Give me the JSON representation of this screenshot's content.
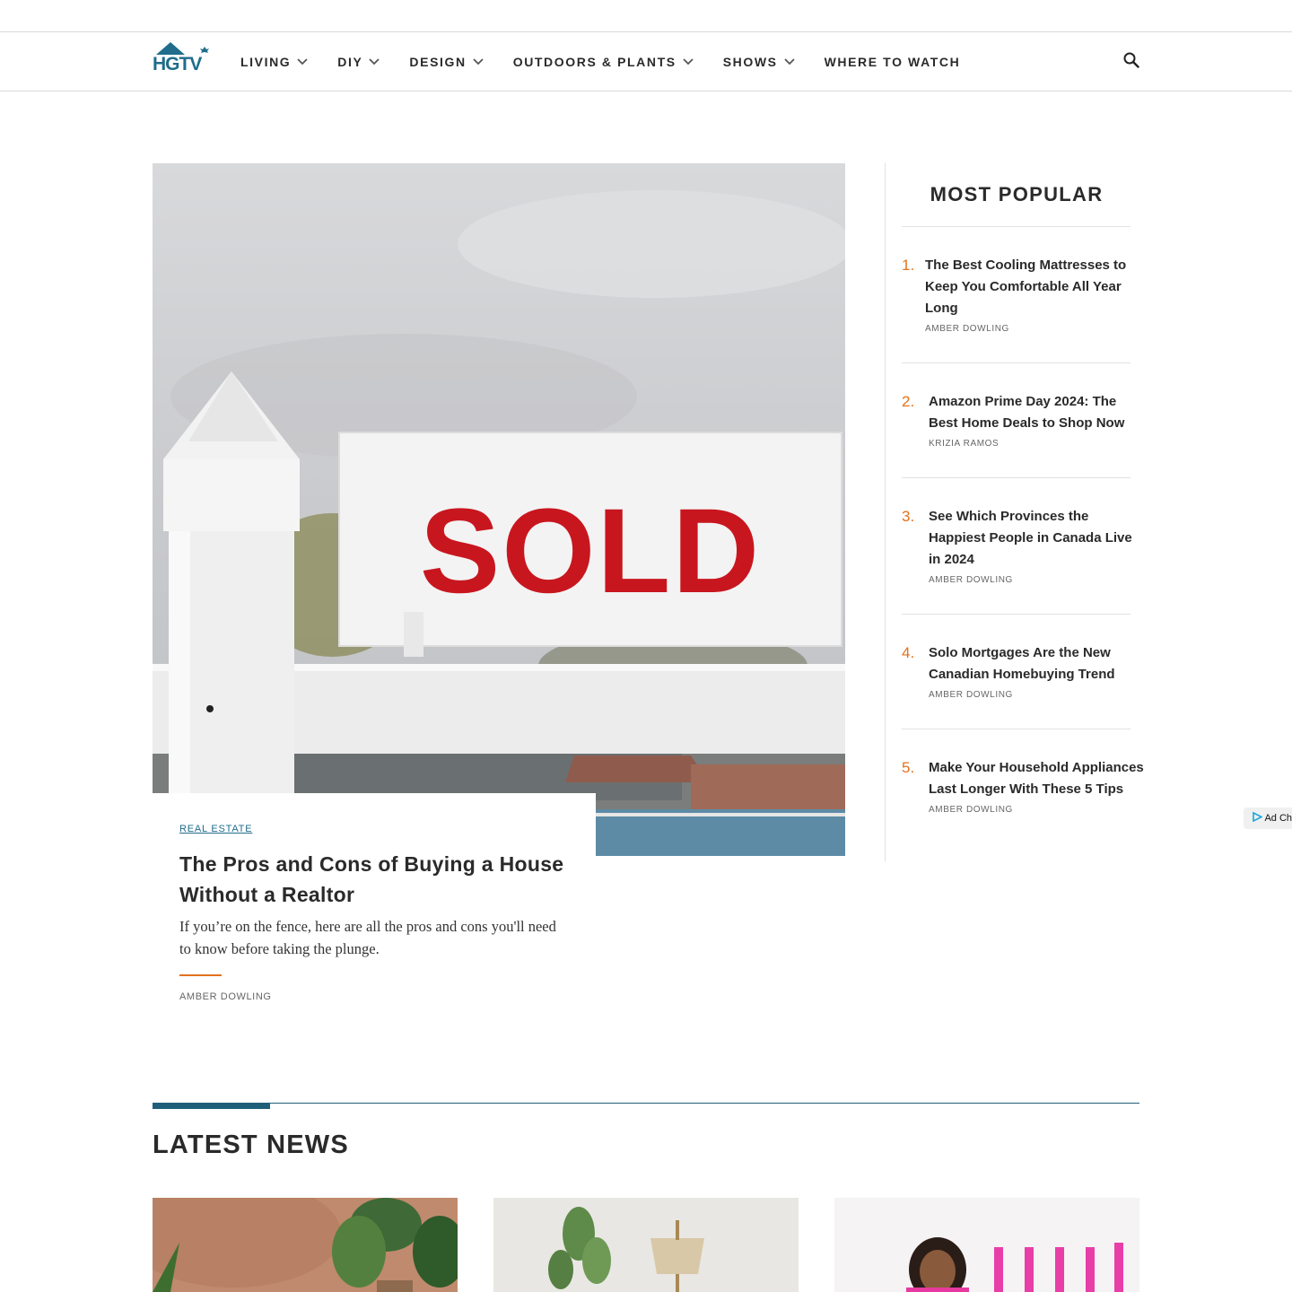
{
  "brand": {
    "logo_text": "HGTV",
    "accent_color": "#1f6d8b",
    "orange": "#e2721d"
  },
  "nav": {
    "items": [
      {
        "label": "LIVING",
        "has_dropdown": true
      },
      {
        "label": "DIY",
        "has_dropdown": true
      },
      {
        "label": "DESIGN",
        "has_dropdown": true
      },
      {
        "label": "OUTDOORS & PLANTS",
        "has_dropdown": true
      },
      {
        "label": "SHOWS",
        "has_dropdown": true
      },
      {
        "label": "WHERE TO WATCH",
        "has_dropdown": false
      }
    ],
    "search_icon": "search-icon"
  },
  "hero": {
    "image_sign_text": "SOLD",
    "category": "REAL ESTATE",
    "title": "The Pros and Cons of Buying a House Without a Realtor",
    "description": "If you’re on the fence, here are all the pros and cons you'll need to know before taking the plunge.",
    "author": "AMBER DOWLING"
  },
  "most_popular": {
    "title": "MOST POPULAR",
    "items": [
      {
        "num": "1.",
        "headline": "The Best Cooling Mattresses to Keep You Comfortable All Year Long",
        "author": "AMBER DOWLING"
      },
      {
        "num": "2.",
        "headline": "Amazon Prime Day 2024: The Best Home Deals to Shop Now",
        "author": "KRIZIA RAMOS"
      },
      {
        "num": "3.",
        "headline": "See Which Provinces the Happiest People in Canada Live in 2024",
        "author": "AMBER DOWLING"
      },
      {
        "num": "4.",
        "headline": "Solo Mortgages Are the New Canadian Homebuying Trend",
        "author": "AMBER DOWLING"
      },
      {
        "num": "5.",
        "headline": "Make Your Household Appliances Last Longer With These 5 Tips",
        "author": "AMBER DOWLING"
      }
    ]
  },
  "ad_choices": {
    "label": "Ad Choices"
  },
  "latest_news": {
    "title": "LATEST NEWS"
  }
}
